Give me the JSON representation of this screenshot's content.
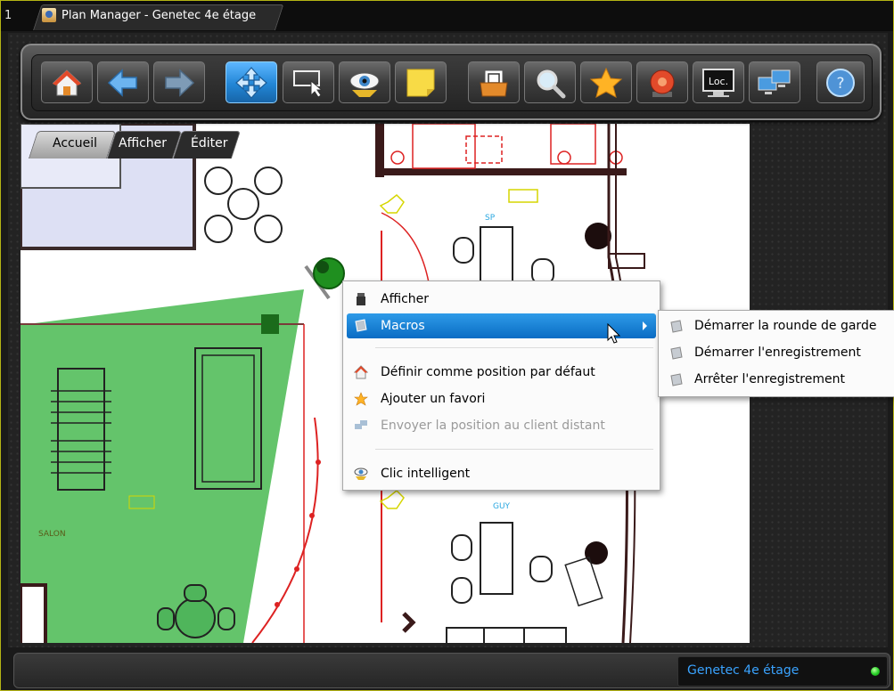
{
  "window": {
    "tab_number": "1",
    "title": "Plan Manager - Genetec 4e étage"
  },
  "toolbar": {
    "buttons": [
      {
        "name": "home-button",
        "icon": "home-icon"
      },
      {
        "name": "back-button",
        "icon": "arrow-left-icon"
      },
      {
        "name": "forward-button",
        "icon": "arrow-right-icon"
      },
      {
        "name": "pan-button",
        "icon": "move-icon",
        "active": true
      },
      {
        "name": "select-area-button",
        "icon": "select-area-icon"
      },
      {
        "name": "smart-click-button",
        "icon": "eye-icon"
      },
      {
        "name": "annotation-button",
        "icon": "sticky-note-icon"
      },
      {
        "name": "archive-button",
        "icon": "archive-icon"
      },
      {
        "name": "search-button",
        "icon": "magnifier-icon"
      },
      {
        "name": "favorites-button",
        "icon": "star-icon"
      },
      {
        "name": "alarm-button",
        "icon": "alarm-bell-icon"
      },
      {
        "name": "location-button",
        "icon": "monitor-loc-icon",
        "label": "Loc."
      },
      {
        "name": "remote-client-button",
        "icon": "network-monitors-icon"
      },
      {
        "name": "help-button",
        "icon": "help-icon"
      }
    ]
  },
  "tabs": [
    {
      "label": "Accueil",
      "active": true
    },
    {
      "label": "Afficher",
      "active": false
    },
    {
      "label": "Éditer",
      "active": false
    }
  ],
  "plan": {
    "room_label": "SALON",
    "label_sp": "SP",
    "label_guy": "GUY",
    "camera_color": "#1f8f1f",
    "fov_color": "#5cc163"
  },
  "context_menu": {
    "items": [
      {
        "label": "Afficher",
        "icon": "camera-icon"
      },
      {
        "label": "Macros",
        "icon": "macro-scroll-icon",
        "highlighted": true,
        "has_submenu": true
      },
      {
        "label": "Définir comme position par défaut",
        "icon": "home-icon"
      },
      {
        "label": "Ajouter un favori",
        "icon": "star-icon"
      },
      {
        "label": "Envoyer la position au client distant",
        "icon": "network-monitors-icon",
        "disabled": true
      },
      {
        "label": "Clic intelligent",
        "icon": "eye-icon"
      }
    ],
    "submenu": [
      {
        "label": "Démarrer la rounde de garde",
        "icon": "macro-scroll-icon"
      },
      {
        "label": "Démarrer l'enregistrement",
        "icon": "macro-scroll-icon"
      },
      {
        "label": "Arrêter l'enregistrement",
        "icon": "macro-scroll-icon"
      }
    ]
  },
  "status": {
    "location": "Genetec 4e étage",
    "indicator_color": "#2bd42b"
  },
  "colors": {
    "accent": "#2286d6",
    "frame": "#b4b414",
    "status_text": "#3aa3ff"
  }
}
